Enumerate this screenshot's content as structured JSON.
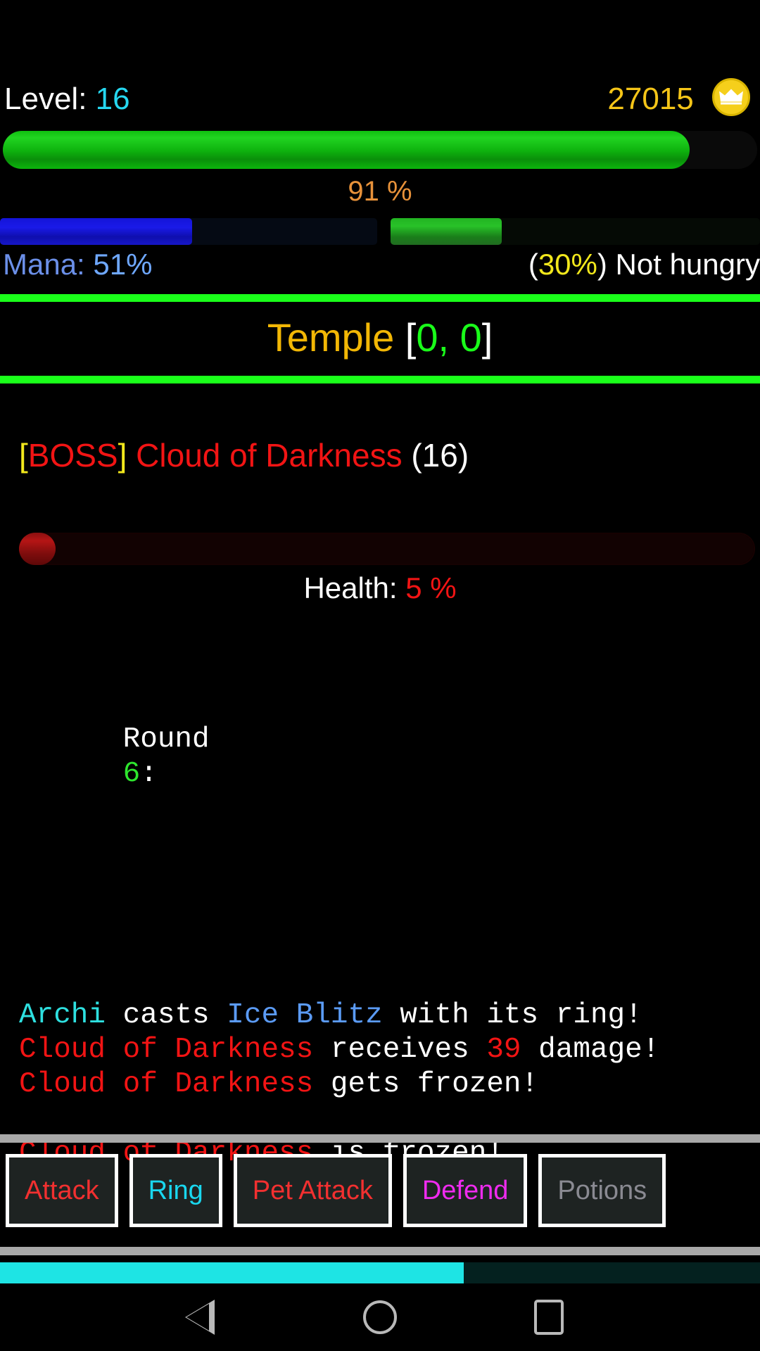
{
  "screen": {
    "background": "#000000"
  },
  "hud": {
    "level_label": "Level:",
    "level_value": "16",
    "coins": "27015",
    "coin_icon": "crown-coin-icon",
    "xp_percent_text": "91 %",
    "xp_percent": 91,
    "mana_label": "Mana:",
    "mana_value": "51%",
    "mana_percent": 51,
    "hunger_percent_text": "30%",
    "hunger_percent": 30,
    "hunger_status": "Not hungry",
    "hunger_prefix": "(",
    "hunger_suffix": ") "
  },
  "location": {
    "name": "Temple",
    "bracket_open": "[",
    "coords": "0, 0",
    "bracket_close": "]"
  },
  "enemy": {
    "tag_open": "[",
    "tag": "BOSS",
    "tag_close": "]",
    "name": "Cloud of Darkness",
    "level": "(16)",
    "health_label": "Health:",
    "health_value": "5 %",
    "health_percent": 5
  },
  "combat": {
    "round_label": "Round",
    "round_number": "6",
    "round_colon": ":",
    "lines": [
      {
        "segments": [
          {
            "text": "Archi",
            "color": "cyan"
          },
          {
            "text": " casts ",
            "color": "white"
          },
          {
            "text": "Ice Blitz",
            "color": "blue"
          },
          {
            "text": " with its ring!",
            "color": "white"
          }
        ]
      },
      {
        "segments": [
          {
            "text": "Cloud of Darkness",
            "color": "red"
          },
          {
            "text": " receives ",
            "color": "white"
          },
          {
            "text": "39",
            "color": "red"
          },
          {
            "text": " damage!",
            "color": "white"
          }
        ]
      },
      {
        "segments": [
          {
            "text": "Cloud of Darkness",
            "color": "red"
          },
          {
            "text": " gets frozen!",
            "color": "white"
          }
        ]
      },
      {
        "segments": [
          {
            "text": "",
            "color": "white"
          }
        ]
      },
      {
        "segments": [
          {
            "text": "Cloud of Darkness",
            "color": "red"
          },
          {
            "text": " is frozen!",
            "color": "white"
          }
        ]
      }
    ]
  },
  "actions": [
    {
      "label": "Attack",
      "color": "#f23030",
      "enabled": true
    },
    {
      "label": "Ring",
      "color": "#19d7ef",
      "enabled": true
    },
    {
      "label": "Pet Attack",
      "color": "#f23030",
      "enabled": true
    },
    {
      "label": "Defend",
      "color": "#ef2bef",
      "enabled": true
    },
    {
      "label": "Potions",
      "color": "#8a8a92",
      "enabled": false
    }
  ],
  "timer": {
    "percent": 61,
    "color": "#1ee4e4"
  },
  "navbar": {
    "back": "back-triangle-icon",
    "home": "home-circle-icon",
    "recents": "recents-square-icon"
  },
  "colors": {
    "accent_green": "#1aff1a",
    "gold": "#f2b705",
    "enemy_red": "#f21414",
    "mana_blue": "#6fa8ff",
    "xp_orange": "#e8923a"
  }
}
